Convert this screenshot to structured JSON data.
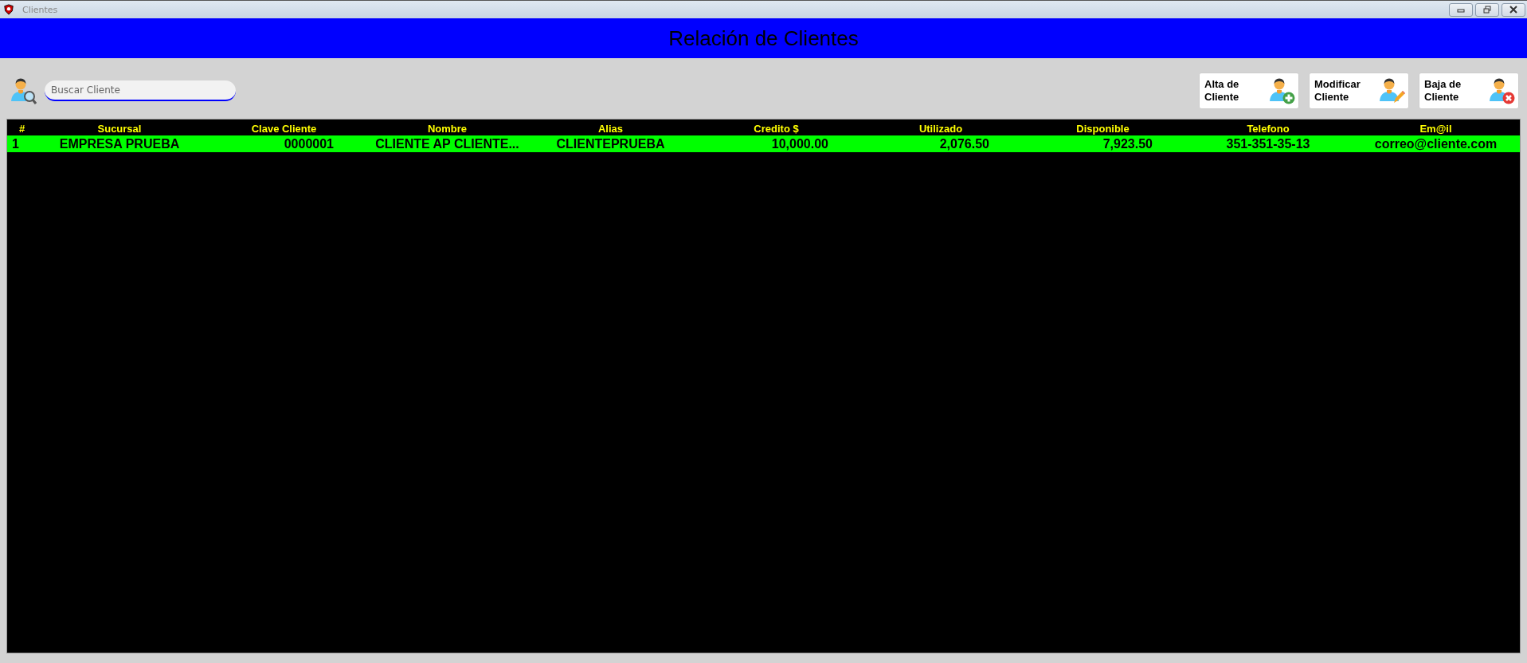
{
  "window": {
    "title": "Clientes"
  },
  "header": {
    "title": "Relación de Clientes"
  },
  "search": {
    "placeholder": "Buscar Cliente"
  },
  "actions": [
    {
      "label": "Alta de Cliente",
      "kind": "add"
    },
    {
      "label": "Modificar Cliente",
      "kind": "edit"
    },
    {
      "label": "Baja de Cliente",
      "kind": "delete"
    }
  ],
  "table": {
    "columns": [
      "#",
      "Sucursal",
      "Clave Cliente",
      "Nombre",
      "Alias",
      "Credito $",
      "Utilizado",
      "Disponible",
      "Telefono",
      "Em@il"
    ],
    "rows": [
      {
        "selected": true,
        "cells": [
          "1",
          "EMPRESA PRUEBA",
          "0000001",
          "CLIENTE AP CLIENTE...",
          "CLIENTEPRUEBA",
          "10,000.00",
          "2,076.50",
          "7,923.50",
          "351-351-35-13",
          "correo@cliente.com"
        ]
      }
    ]
  }
}
